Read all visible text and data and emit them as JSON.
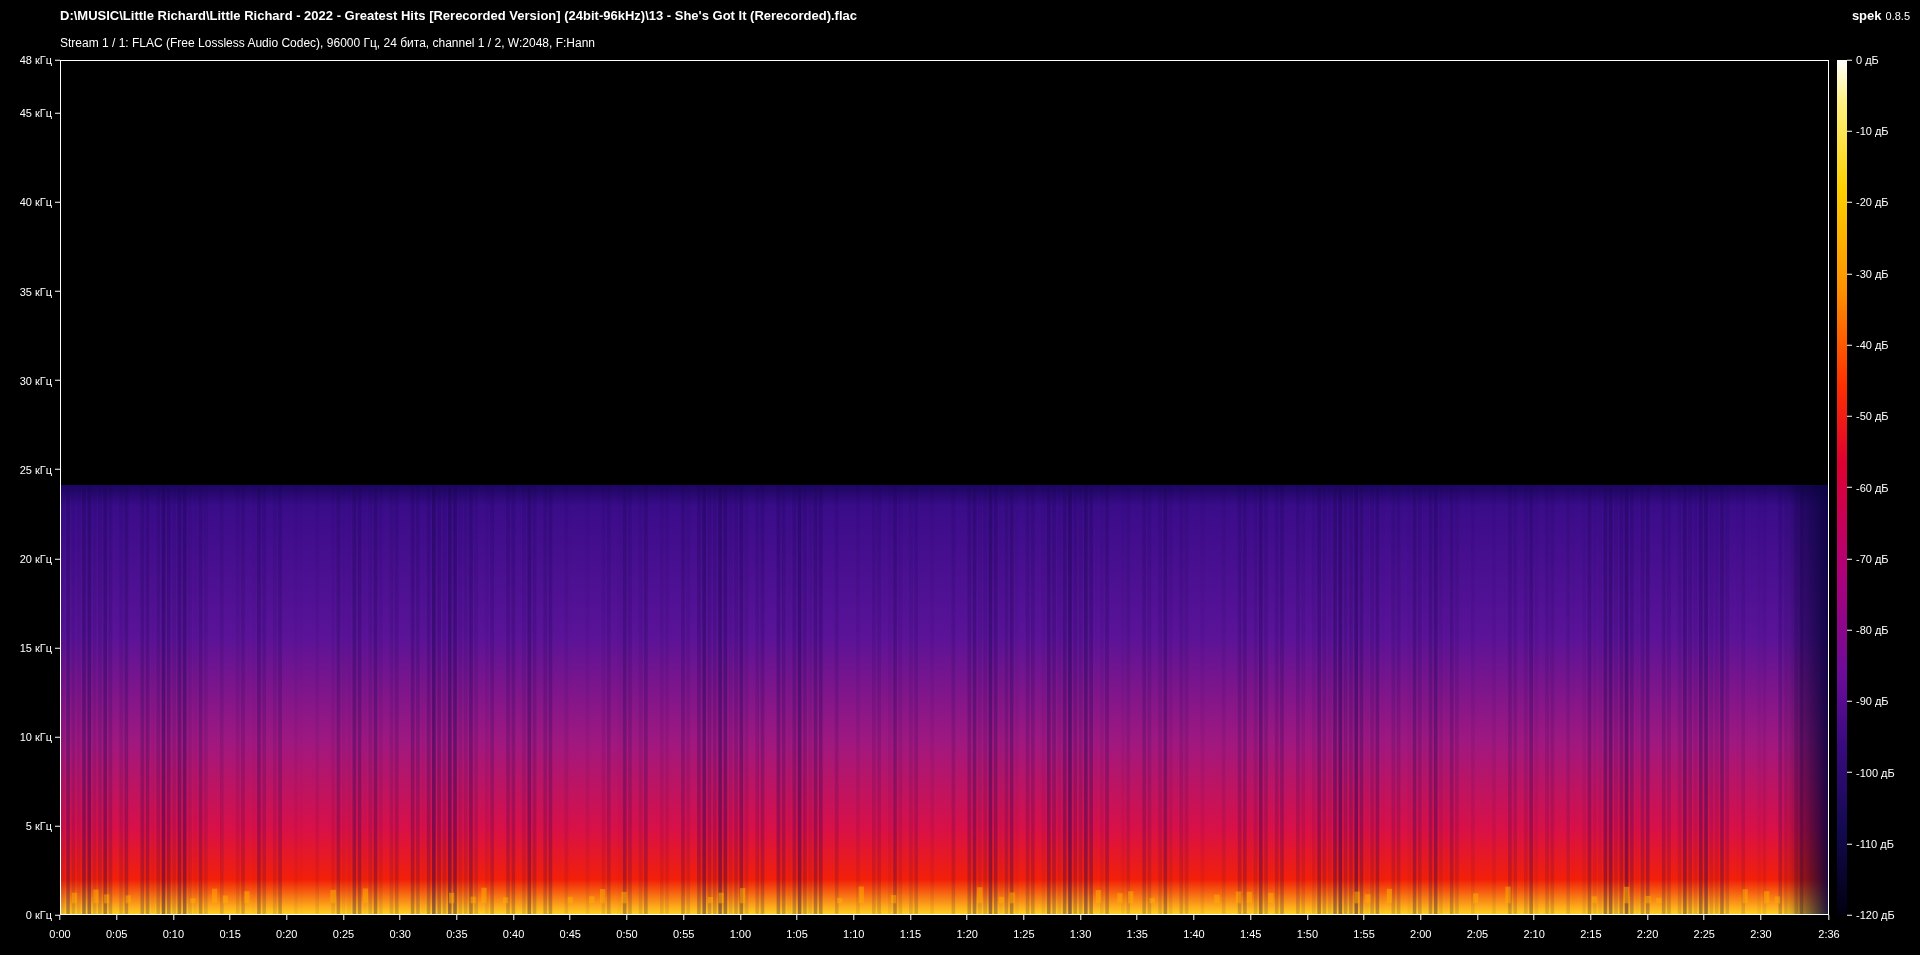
{
  "header": {
    "file_path": "D:\\MUSIC\\Little Richard\\Little Richard - 2022 - Greatest Hits [Rerecorded Version] (24bit-96kHz)\\13 - She's Got It (Rerecorded).flac",
    "stream_info": "Stream 1 / 1: FLAC (Free Lossless Audio Codec), 96000 Гц, 24 бита, channel 1 / 2, W:2048, F:Hann",
    "app_name": "spek",
    "app_version": "0.8.5"
  },
  "frequency_axis": {
    "labels": [
      "48 кГц",
      "45 кГц",
      "40 кГц",
      "35 кГц",
      "30 кГц",
      "25 кГц",
      "20 кГц",
      "15 кГц",
      "10 кГц",
      "5 кГц",
      "0 кГц"
    ]
  },
  "time_axis": {
    "labels": [
      "0:00",
      "0:05",
      "0:10",
      "0:15",
      "0:20",
      "0:25",
      "0:30",
      "0:35",
      "0:40",
      "0:45",
      "0:50",
      "0:55",
      "1:00",
      "1:05",
      "1:10",
      "1:15",
      "1:20",
      "1:25",
      "1:30",
      "1:35",
      "1:40",
      "1:45",
      "1:50",
      "1:55",
      "2:00",
      "2:05",
      "2:10",
      "2:15",
      "2:20",
      "2:25",
      "2:30",
      "2:36"
    ]
  },
  "db_scale": {
    "labels": [
      "0 дБ",
      "-10 дБ",
      "-20 дБ",
      "-30 дБ",
      "-40 дБ",
      "-50 дБ",
      "-60 дБ",
      "-70 дБ",
      "-80 дБ",
      "-90 дБ",
      "-100 дБ",
      "-110 дБ",
      "-120 дБ"
    ]
  }
}
